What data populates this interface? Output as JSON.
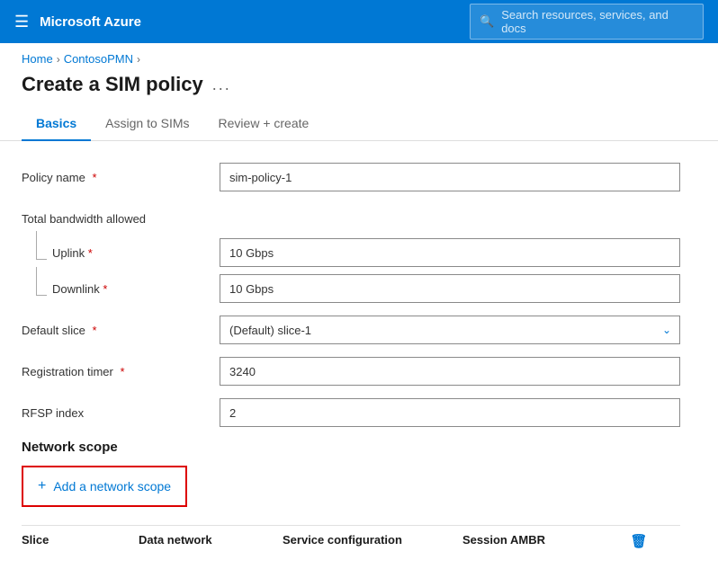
{
  "topnav": {
    "logo": "Microsoft Azure",
    "search_placeholder": "Search resources, services, and docs"
  },
  "breadcrumb": {
    "home": "Home",
    "parent": "ContosoPMN"
  },
  "page": {
    "title": "Create a SIM policy",
    "ellipsis": "..."
  },
  "tabs": [
    {
      "id": "basics",
      "label": "Basics",
      "active": true
    },
    {
      "id": "assign-sims",
      "label": "Assign to SIMs",
      "active": false
    },
    {
      "id": "review-create",
      "label": "Review + create",
      "active": false
    }
  ],
  "form": {
    "policy_name_label": "Policy name",
    "policy_name_value": "sim-policy-1",
    "bandwidth_label": "Total bandwidth allowed",
    "uplink_label": "Uplink",
    "uplink_value": "10 Gbps",
    "downlink_label": "Downlink",
    "downlink_value": "10 Gbps",
    "default_slice_label": "Default slice",
    "default_slice_value": "(Default) slice-1",
    "registration_timer_label": "Registration timer",
    "registration_timer_value": "3240",
    "rfsp_index_label": "RFSP index",
    "rfsp_index_value": "2",
    "required_marker": "*"
  },
  "network_scope": {
    "section_title": "Network scope",
    "add_button_label": "Add a network scope",
    "plus_symbol": "+"
  },
  "table": {
    "col_slice": "Slice",
    "col_data_network": "Data network",
    "col_service_config": "Service configuration",
    "col_session_ambr": "Session AMBR",
    "col_action_icon": "🗑"
  }
}
